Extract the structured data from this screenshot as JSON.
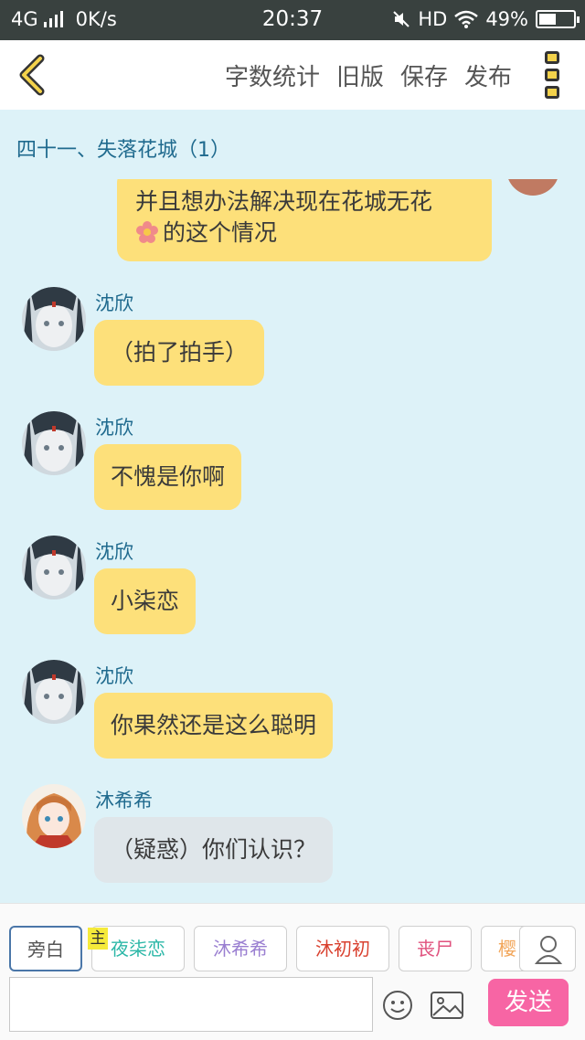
{
  "status_bar": {
    "network": "4G",
    "speed": "0K/s",
    "time": "20:37",
    "hd": "HD",
    "battery": "49%"
  },
  "toolbar": {
    "items": [
      "字数统计",
      "旧版",
      "保存",
      "发布"
    ]
  },
  "chapter_title": "四十一、失落花城（1）",
  "top_bubble": {
    "line1": "并且想办法解决现在花城无花",
    "line2": "的这个情况"
  },
  "messages": [
    {
      "name": "沈欣",
      "text": "（拍了拍手）"
    },
    {
      "name": "沈欣",
      "text": "不愧是你啊"
    },
    {
      "name": "沈欣",
      "text": "小柒恋"
    },
    {
      "name": "沈欣",
      "text": "你果然还是这么聪明"
    },
    {
      "name": "沐希希",
      "text": "（疑惑）你们认识？"
    }
  ],
  "role_tabs": [
    {
      "label": "旁白",
      "color": "#555555"
    },
    {
      "label": "夜柒恋",
      "color": "#2bb7a7"
    },
    {
      "label": "沐希希",
      "color": "#9a7fd1"
    },
    {
      "label": "沐初初",
      "color": "#d9412f"
    },
    {
      "label": "丧尸",
      "color": "#e0527e"
    },
    {
      "label": "樱",
      "color": "#f2a65a"
    }
  ],
  "host_badge": "主",
  "send_label": "发送",
  "colors": {
    "chat_bg": "#ddf2f8",
    "bubble_yellow": "#fde07a",
    "bubble_grey": "#dfe6ea",
    "send_pink": "#f765a4",
    "name_blue": "#1f6a8e"
  }
}
